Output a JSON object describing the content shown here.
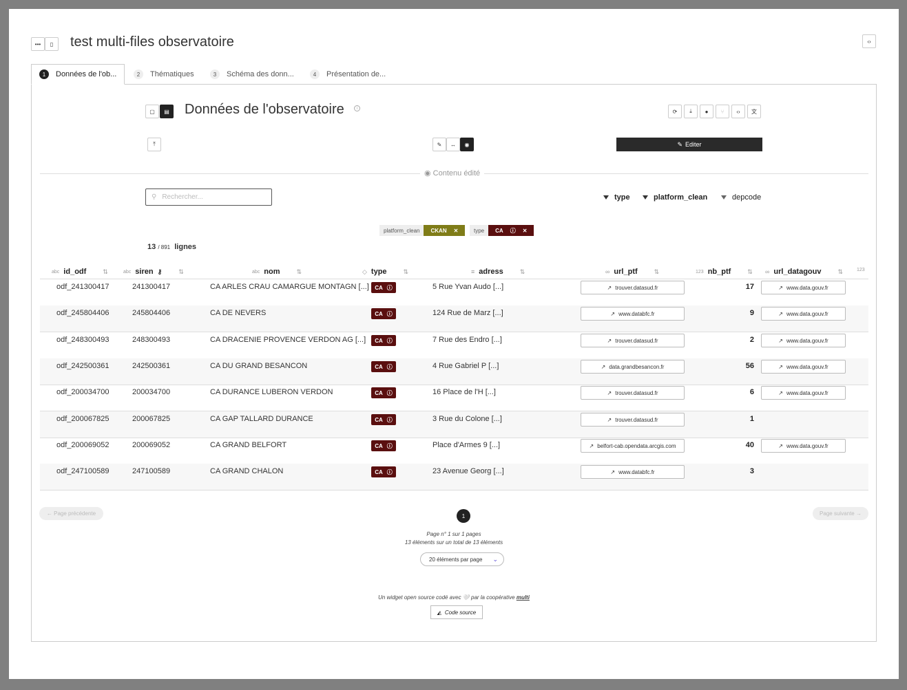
{
  "app": {
    "title": "test multi-files observatoire"
  },
  "tabs": [
    {
      "num": "1",
      "label": "Données de l'ob..."
    },
    {
      "num": "2",
      "label": "Thématiques"
    },
    {
      "num": "3",
      "label": "Schéma des donn..."
    },
    {
      "num": "4",
      "label": "Présentation de..."
    }
  ],
  "section": {
    "title": "Données de l'observatoire",
    "edit_label": "Editer",
    "divider_label": "Contenu édité",
    "search_placeholder": "Rechercher..."
  },
  "filters": [
    "type",
    "platform_clean",
    "depcode"
  ],
  "active_filters": [
    {
      "key": "platform_clean",
      "value": "CKAN",
      "color": "#7f7c18"
    },
    {
      "key": "type",
      "value": "CA",
      "color": "#5a0f0f"
    }
  ],
  "count": {
    "shown": "13",
    "total": "/ 891",
    "label": "lignes"
  },
  "columns": {
    "id_odf": "id_odf",
    "siren": "siren",
    "nom": "nom",
    "type": "type",
    "adress": "adress",
    "url_ptf": "url_ptf",
    "nb_ptf": "nb_ptf",
    "url_datagouv": "url_datagouv"
  },
  "column_type_icons": {
    "text": "abc",
    "number": "123"
  },
  "rows": [
    {
      "id_odf": "odf_241300417",
      "siren": "241300417",
      "nom": "CA ARLES CRAU CAMARGUE MONTAGN [...]",
      "type": "CA",
      "adress": "5 Rue Yvan Audo [...]",
      "url_ptf": "trouver.datasud.fr",
      "nb_ptf": "17",
      "url_datagouv": "www.data.gouv.fr"
    },
    {
      "id_odf": "odf_245804406",
      "siren": "245804406",
      "nom": "CA DE NEVERS",
      "type": "CA",
      "adress": "124 Rue de Marz [...]",
      "url_ptf": "www.databfc.fr",
      "nb_ptf": "9",
      "url_datagouv": "www.data.gouv.fr"
    },
    {
      "id_odf": "odf_248300493",
      "siren": "248300493",
      "nom": "CA DRACENIE PROVENCE VERDON AG [...]",
      "type": "CA",
      "adress": "7 Rue des Endro [...]",
      "url_ptf": "trouver.datasud.fr",
      "nb_ptf": "2",
      "url_datagouv": "www.data.gouv.fr"
    },
    {
      "id_odf": "odf_242500361",
      "siren": "242500361",
      "nom": "CA DU GRAND BESANCON",
      "type": "CA",
      "adress": "4 Rue Gabriel P [...]",
      "url_ptf": "data.grandbesancon.fr",
      "nb_ptf": "56",
      "url_datagouv": "www.data.gouv.fr"
    },
    {
      "id_odf": "odf_200034700",
      "siren": "200034700",
      "nom": "CA DURANCE LUBERON VERDON",
      "type": "CA",
      "adress": "16 Place de l'H [...]",
      "url_ptf": "trouver.datasud.fr",
      "nb_ptf": "6",
      "url_datagouv": "www.data.gouv.fr"
    },
    {
      "id_odf": "odf_200067825",
      "siren": "200067825",
      "nom": "CA GAP TALLARD DURANCE",
      "type": "CA",
      "adress": "3 Rue du Colone [...]",
      "url_ptf": "trouver.datasud.fr",
      "nb_ptf": "1",
      "url_datagouv": ""
    },
    {
      "id_odf": "odf_200069052",
      "siren": "200069052",
      "nom": "CA GRAND BELFORT",
      "type": "CA",
      "adress": "Place d'Armes 9 [...]",
      "url_ptf": "belfort-cab.opendata.arcgis.com",
      "nb_ptf": "40",
      "url_datagouv": "www.data.gouv.fr"
    },
    {
      "id_odf": "odf_247100589",
      "siren": "247100589",
      "nom": "CA GRAND CHALON",
      "type": "CA",
      "adress": "23 Avenue Georg [...]",
      "url_ptf": "www.databfc.fr",
      "nb_ptf": "3",
      "url_datagouv": ""
    }
  ],
  "pagination": {
    "prev": "← Page précédente",
    "next": "Page suivante →",
    "current": "1",
    "info": "Page n° 1 sur 1 pages",
    "elements": "13 éléments sur un total de 13 éléments",
    "per_page": "20 éléments par page"
  },
  "footer": {
    "text_before": "Un widget open source codé avec 🤍  par la coopérative",
    "link": "multi",
    "source_button": "Code source"
  }
}
